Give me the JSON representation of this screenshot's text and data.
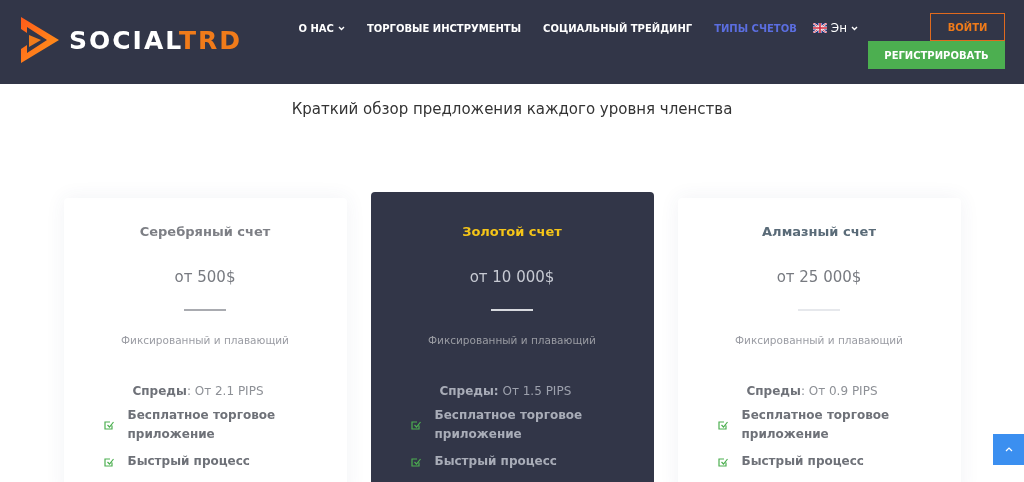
{
  "header": {
    "logo": {
      "part_1": "SOCIAL",
      "part_2": "TRD"
    },
    "nav": [
      {
        "label": "О НАС",
        "has_menu": true,
        "selected": false
      },
      {
        "label": "ТОРГОВЫЕ ИНСТРУМЕНТЫ",
        "has_menu": false,
        "selected": false
      },
      {
        "label": "СОЦИАЛЬНЫЙ ТРЕЙДИНГ",
        "has_menu": false,
        "selected": false
      },
      {
        "label": "ТИПЫ СЧЕТОВ",
        "has_menu": false,
        "selected": true
      }
    ],
    "language": "Эн",
    "login": "ВОЙТИ",
    "register": "РЕГИСТРИРОВАТЬ"
  },
  "heading": "Краткий обзор предложения каждого уровня членства",
  "plans": [
    {
      "kind": "light",
      "color": "#7d7f85",
      "title": "Серебряный счет",
      "price": "от 500$",
      "type": "Фиксированный и плавающий",
      "spreads": "**Спреды**: От 2.1 PIPS",
      "features": [
        "Бесплатное торговое приложение",
        "Быстрый процесс"
      ]
    },
    {
      "kind": "dark",
      "color": "#f5c518",
      "title": "Золотой счет",
      "price": "от 10 000$",
      "type": "Фиксированный и плавающий",
      "spreads": "**Спреды:** От 1.5 PIPS",
      "features": [
        "Бесплатное торговое приложение",
        "Быстрый процесс"
      ]
    },
    {
      "kind": "light",
      "color": "#5a6b78",
      "title": "Алмазный счет",
      "price": "от 25 000$",
      "type": "Фиксированный и плавающий",
      "spreads": "**Спреды**: От 0.9 PIPS",
      "features": [
        "Бесплатное торговое приложение",
        "Быстрый процесс"
      ]
    }
  ]
}
